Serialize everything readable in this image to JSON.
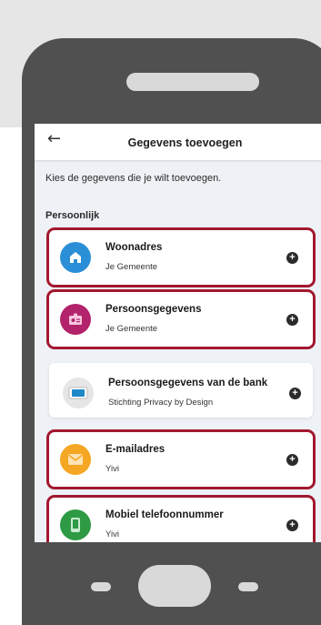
{
  "appbar": {
    "title": "Gegevens toevoegen",
    "back_icon": "arrow-left-icon"
  },
  "instruction": "Kies de gegevens die je wilt toevoegen.",
  "section_title": "Persoonlijk",
  "cards": [
    {
      "title": "Woonadres",
      "subtitle": "Je Gemeente",
      "icon": "home-icon",
      "icon_color": "#2a8fd6",
      "selected": true
    },
    {
      "title": "Persoonsgegevens",
      "subtitle": "Je Gemeente",
      "icon": "id-card-icon",
      "icon_color": "#b2236b",
      "selected": true
    },
    {
      "title": "Persoonsgegevens van de bank",
      "subtitle": "Stichting Privacy by Design",
      "icon": "bank-idin-icon",
      "icon_color": "#e6e6e6",
      "selected": false
    },
    {
      "title": "E-mailadres",
      "subtitle": "Yivi",
      "icon": "mail-icon",
      "icon_color": "#f5a623",
      "selected": true
    },
    {
      "title": "Mobiel telefoonnummer",
      "subtitle": "Yivi",
      "icon": "phone-icon",
      "icon_color": "#2e9a44",
      "selected": true
    }
  ],
  "colors": {
    "selection_border": "#a3182f",
    "phone_frame": "#505050",
    "content_bg": "#eef2f6"
  }
}
